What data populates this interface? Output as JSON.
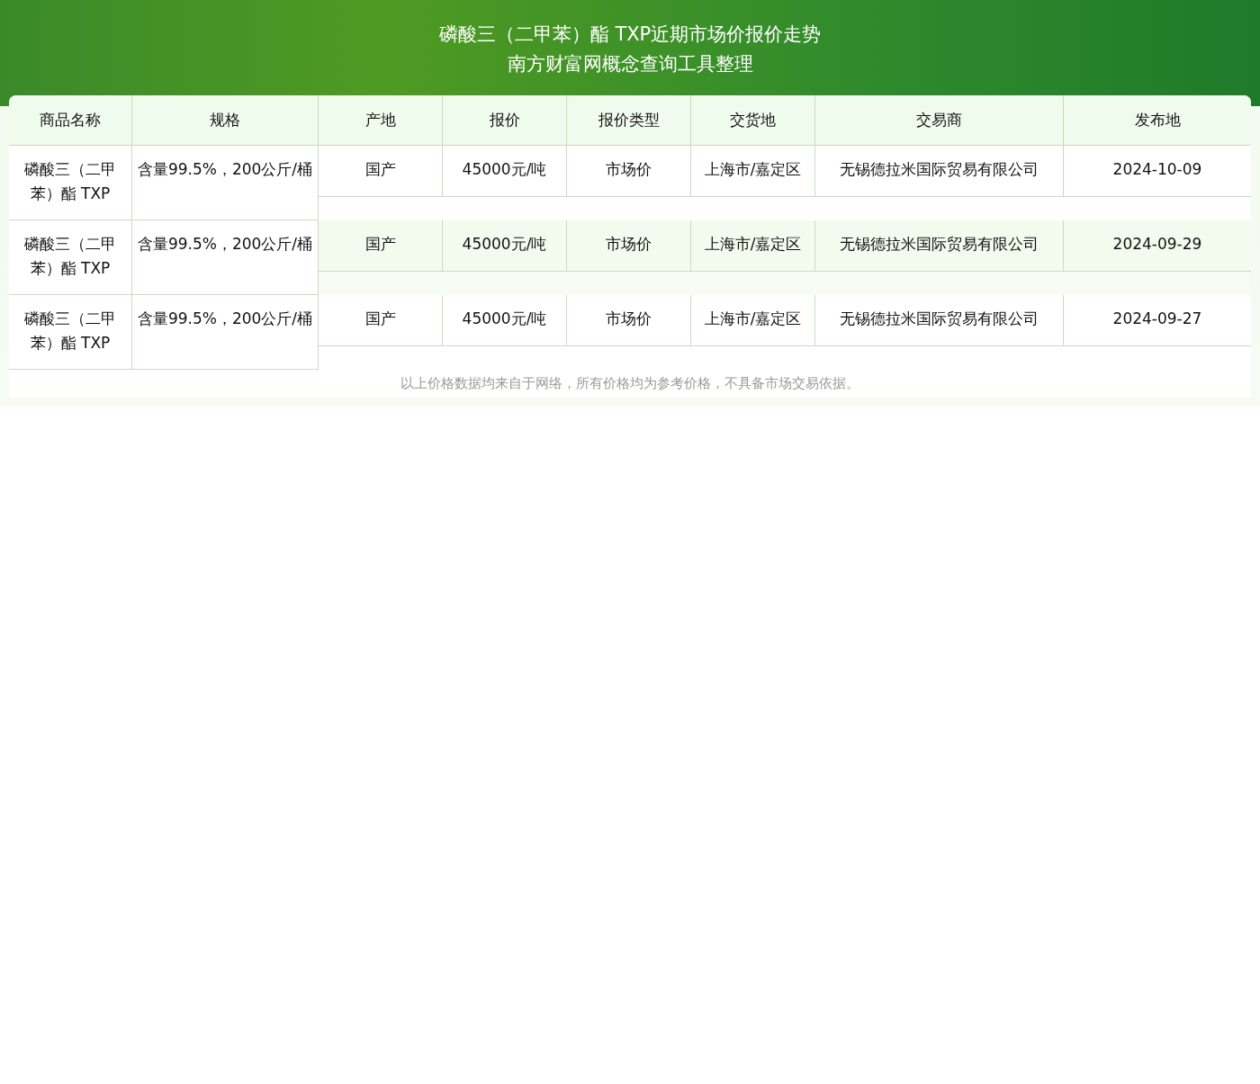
{
  "title": {
    "line1": "磷酸三（二甲苯）酯 TXP近期市场价报价走势",
    "line2": "南方财富网概念查询工具整理"
  },
  "table": {
    "columns": [
      "商品名称",
      "规格",
      "产地",
      "报价",
      "报价类型",
      "交货地",
      "交易商",
      "发布地"
    ],
    "rows": [
      {
        "cells": [
          "磷酸三（二甲苯）酯 TXP",
          "含量99.5%，200公斤/桶",
          "国产",
          "45000元/吨",
          "市场价",
          "上海市/嘉定区",
          "无锡德拉米国际贸易有限公司",
          "2024-10-09"
        ]
      },
      {
        "cells": [
          "磷酸三（二甲苯）酯 TXP",
          "含量99.5%，200公斤/桶",
          "国产",
          "45000元/吨",
          "市场价",
          "上海市/嘉定区",
          "无锡德拉米国际贸易有限公司",
          "2024-09-29"
        ]
      },
      {
        "cells": [
          "磷酸三（二甲苯）酯 TXP",
          "含量99.5%，200公斤/桶",
          "国产",
          "45000元/吨",
          "市场价",
          "上海市/嘉定区",
          "无锡德拉米国际贸易有限公司",
          "2024-09-27"
        ]
      }
    ]
  },
  "note": "以上价格数据均来自于网络，所有价格均为参考价格，不具备市场交易依据。"
}
